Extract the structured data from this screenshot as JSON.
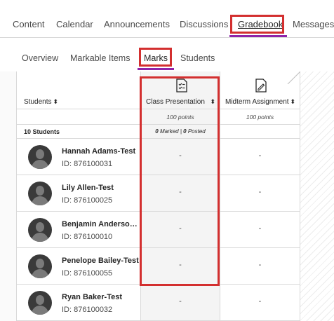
{
  "top_tabs": [
    {
      "label": "Content"
    },
    {
      "label": "Calendar"
    },
    {
      "label": "Announcements"
    },
    {
      "label": "Discussions"
    },
    {
      "label": "Gradebook"
    },
    {
      "label": "Messages"
    }
  ],
  "sub_tabs": [
    {
      "label": "Overview"
    },
    {
      "label": "Markable Items"
    },
    {
      "label": "Marks"
    },
    {
      "label": "Students"
    }
  ],
  "grid": {
    "students_header": "Students",
    "students_count": "10",
    "students_count_suffix": " Students",
    "columns": [
      {
        "title": "Class Presentation",
        "points": "100 points",
        "marked_count": "0",
        "marked_label": " Marked | ",
        "posted_count": "0",
        "posted_label": " Posted"
      },
      {
        "title": "Midterm Assignment",
        "points": "100 points"
      }
    ],
    "rows": [
      {
        "name": "Hannah Adams-Test",
        "id": "ID: 876100031",
        "grade_a": "-",
        "grade_b": "-"
      },
      {
        "name": "Lily Allen-Test",
        "id": "ID: 876100025",
        "grade_a": "-",
        "grade_b": "-"
      },
      {
        "name": "Benjamin Anderson-Test",
        "id": "ID: 876100010",
        "grade_a": "-",
        "grade_b": "-"
      },
      {
        "name": "Penelope Bailey-Test",
        "id": "ID: 876100055",
        "grade_a": "-",
        "grade_b": "-"
      },
      {
        "name": "Ryan Baker-Test",
        "id": "ID: 876100032",
        "grade_a": "-",
        "grade_b": "-"
      }
    ]
  },
  "colors": {
    "highlight": "#d32f2f",
    "active_tab_underline": "#8e24aa"
  },
  "icons": {
    "assignment_a": "document-checklist-icon",
    "assignment_b": "document-edit-icon",
    "sort": "sort-arrows-icon",
    "avatar": "user-silhouette-icon"
  }
}
